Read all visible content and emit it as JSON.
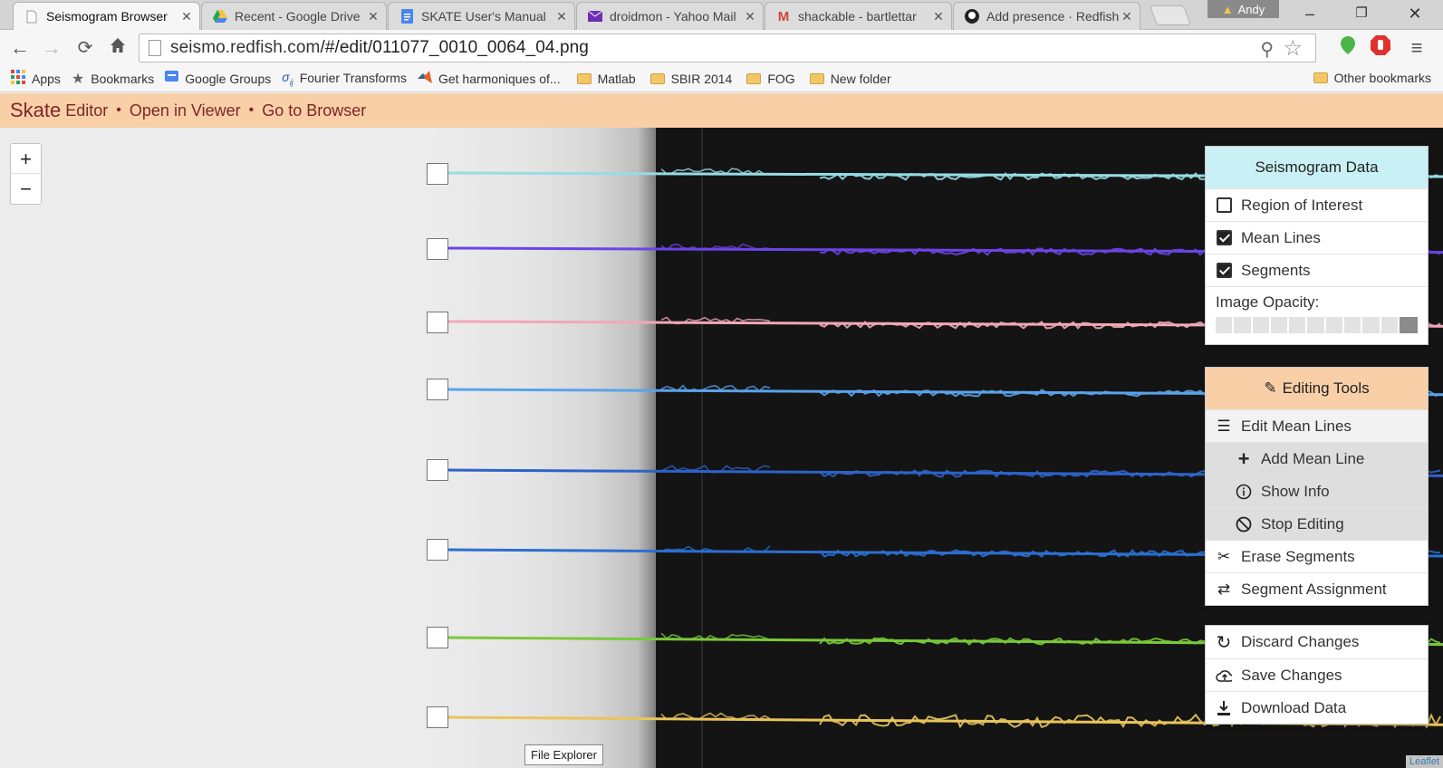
{
  "browser": {
    "tabs": [
      {
        "title": "Seismogram Browser",
        "icon": "page-icon",
        "active": true
      },
      {
        "title": "Recent - Google Drive",
        "icon": "google-drive-icon"
      },
      {
        "title": "SKATE User's Manual",
        "icon": "google-docs-icon"
      },
      {
        "title": "droidmon - Yahoo Mail",
        "icon": "yahoo-mail-icon"
      },
      {
        "title": "shackable - bartlettar",
        "icon": "gmail-icon"
      },
      {
        "title": "Add presence · Redfish",
        "icon": "github-icon"
      }
    ],
    "profile_name": "Andy",
    "url_host": "seismo.redfish.com",
    "url_path": "/#/edit/011077_0010_0064_04.png",
    "bookmarks": [
      {
        "label": "Apps",
        "icon": "apps-grid-icon"
      },
      {
        "label": "Bookmarks",
        "icon": "star-icon"
      },
      {
        "label": "Google Groups",
        "icon": "google-groups-icon"
      },
      {
        "label": "Fourier Transforms",
        "icon": "fourier-icon"
      },
      {
        "label": "Get harmoniques of...",
        "icon": "matlab-icon"
      },
      {
        "label": "Matlab",
        "icon": "folder-icon"
      },
      {
        "label": "SBIR 2014",
        "icon": "folder-icon"
      },
      {
        "label": "FOG",
        "icon": "folder-icon"
      },
      {
        "label": "New folder",
        "icon": "folder-icon"
      }
    ],
    "other_bookmarks": "Other bookmarks"
  },
  "app": {
    "brand": "Skate",
    "mode": "Editor",
    "open_viewer": "Open in Viewer",
    "go_browser": "Go to Browser",
    "separator": "•"
  },
  "map": {
    "zoom_in": "+",
    "zoom_out": "−",
    "tooltip": "File Explorer",
    "attribution": "Leaflet"
  },
  "traces": [
    {
      "color": "#96dde3"
    },
    {
      "color": "#6a45e6"
    },
    {
      "color": "#f1a8b7"
    },
    {
      "color": "#5aa3ea"
    },
    {
      "color": "#2d63c9"
    },
    {
      "color": "#2b6fd0"
    },
    {
      "color": "#7ac93a"
    },
    {
      "color": "#e8c55a"
    }
  ],
  "seismogram_panel": {
    "title": "Seismogram Data",
    "header_color": "#c9f0f4",
    "layers": [
      {
        "label": "Region of Interest",
        "checked": false
      },
      {
        "label": "Mean Lines",
        "checked": true
      },
      {
        "label": "Segments",
        "checked": true
      }
    ],
    "opacity_label": "Image Opacity:",
    "opacity_value": 1.0
  },
  "editing_panel": {
    "title": "Editing Tools",
    "header_color": "#f9cfa7",
    "edit_mean_lines": "Edit Mean Lines",
    "sub_items": [
      {
        "label": "Add Mean Line",
        "icon": "plus-icon"
      },
      {
        "label": "Show Info",
        "icon": "info-icon"
      },
      {
        "label": "Stop Editing",
        "icon": "stop-icon"
      }
    ],
    "erase_segments": "Erase Segments",
    "segment_assignment": "Segment Assignment"
  },
  "actions_panel": {
    "discard": "Discard Changes",
    "save": "Save Changes",
    "download": "Download Data"
  }
}
